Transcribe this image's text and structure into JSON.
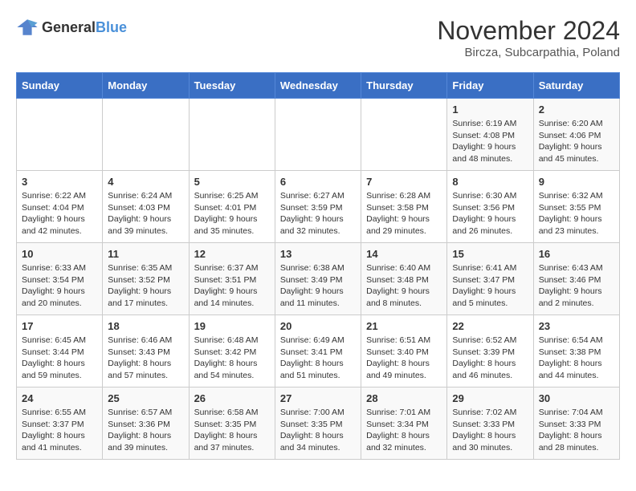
{
  "header": {
    "logo_general": "General",
    "logo_blue": "Blue",
    "month_year": "November 2024",
    "location": "Bircza, Subcarpathia, Poland"
  },
  "days_of_week": [
    "Sunday",
    "Monday",
    "Tuesday",
    "Wednesday",
    "Thursday",
    "Friday",
    "Saturday"
  ],
  "weeks": [
    [
      {
        "day": "",
        "info": ""
      },
      {
        "day": "",
        "info": ""
      },
      {
        "day": "",
        "info": ""
      },
      {
        "day": "",
        "info": ""
      },
      {
        "day": "",
        "info": ""
      },
      {
        "day": "1",
        "info": "Sunrise: 6:19 AM\nSunset: 4:08 PM\nDaylight: 9 hours and 48 minutes."
      },
      {
        "day": "2",
        "info": "Sunrise: 6:20 AM\nSunset: 4:06 PM\nDaylight: 9 hours and 45 minutes."
      }
    ],
    [
      {
        "day": "3",
        "info": "Sunrise: 6:22 AM\nSunset: 4:04 PM\nDaylight: 9 hours and 42 minutes."
      },
      {
        "day": "4",
        "info": "Sunrise: 6:24 AM\nSunset: 4:03 PM\nDaylight: 9 hours and 39 minutes."
      },
      {
        "day": "5",
        "info": "Sunrise: 6:25 AM\nSunset: 4:01 PM\nDaylight: 9 hours and 35 minutes."
      },
      {
        "day": "6",
        "info": "Sunrise: 6:27 AM\nSunset: 3:59 PM\nDaylight: 9 hours and 32 minutes."
      },
      {
        "day": "7",
        "info": "Sunrise: 6:28 AM\nSunset: 3:58 PM\nDaylight: 9 hours and 29 minutes."
      },
      {
        "day": "8",
        "info": "Sunrise: 6:30 AM\nSunset: 3:56 PM\nDaylight: 9 hours and 26 minutes."
      },
      {
        "day": "9",
        "info": "Sunrise: 6:32 AM\nSunset: 3:55 PM\nDaylight: 9 hours and 23 minutes."
      }
    ],
    [
      {
        "day": "10",
        "info": "Sunrise: 6:33 AM\nSunset: 3:54 PM\nDaylight: 9 hours and 20 minutes."
      },
      {
        "day": "11",
        "info": "Sunrise: 6:35 AM\nSunset: 3:52 PM\nDaylight: 9 hours and 17 minutes."
      },
      {
        "day": "12",
        "info": "Sunrise: 6:37 AM\nSunset: 3:51 PM\nDaylight: 9 hours and 14 minutes."
      },
      {
        "day": "13",
        "info": "Sunrise: 6:38 AM\nSunset: 3:49 PM\nDaylight: 9 hours and 11 minutes."
      },
      {
        "day": "14",
        "info": "Sunrise: 6:40 AM\nSunset: 3:48 PM\nDaylight: 9 hours and 8 minutes."
      },
      {
        "day": "15",
        "info": "Sunrise: 6:41 AM\nSunset: 3:47 PM\nDaylight: 9 hours and 5 minutes."
      },
      {
        "day": "16",
        "info": "Sunrise: 6:43 AM\nSunset: 3:46 PM\nDaylight: 9 hours and 2 minutes."
      }
    ],
    [
      {
        "day": "17",
        "info": "Sunrise: 6:45 AM\nSunset: 3:44 PM\nDaylight: 8 hours and 59 minutes."
      },
      {
        "day": "18",
        "info": "Sunrise: 6:46 AM\nSunset: 3:43 PM\nDaylight: 8 hours and 57 minutes."
      },
      {
        "day": "19",
        "info": "Sunrise: 6:48 AM\nSunset: 3:42 PM\nDaylight: 8 hours and 54 minutes."
      },
      {
        "day": "20",
        "info": "Sunrise: 6:49 AM\nSunset: 3:41 PM\nDaylight: 8 hours and 51 minutes."
      },
      {
        "day": "21",
        "info": "Sunrise: 6:51 AM\nSunset: 3:40 PM\nDaylight: 8 hours and 49 minutes."
      },
      {
        "day": "22",
        "info": "Sunrise: 6:52 AM\nSunset: 3:39 PM\nDaylight: 8 hours and 46 minutes."
      },
      {
        "day": "23",
        "info": "Sunrise: 6:54 AM\nSunset: 3:38 PM\nDaylight: 8 hours and 44 minutes."
      }
    ],
    [
      {
        "day": "24",
        "info": "Sunrise: 6:55 AM\nSunset: 3:37 PM\nDaylight: 8 hours and 41 minutes."
      },
      {
        "day": "25",
        "info": "Sunrise: 6:57 AM\nSunset: 3:36 PM\nDaylight: 8 hours and 39 minutes."
      },
      {
        "day": "26",
        "info": "Sunrise: 6:58 AM\nSunset: 3:35 PM\nDaylight: 8 hours and 37 minutes."
      },
      {
        "day": "27",
        "info": "Sunrise: 7:00 AM\nSunset: 3:35 PM\nDaylight: 8 hours and 34 minutes."
      },
      {
        "day": "28",
        "info": "Sunrise: 7:01 AM\nSunset: 3:34 PM\nDaylight: 8 hours and 32 minutes."
      },
      {
        "day": "29",
        "info": "Sunrise: 7:02 AM\nSunset: 3:33 PM\nDaylight: 8 hours and 30 minutes."
      },
      {
        "day": "30",
        "info": "Sunrise: 7:04 AM\nSunset: 3:33 PM\nDaylight: 8 hours and 28 minutes."
      }
    ]
  ]
}
